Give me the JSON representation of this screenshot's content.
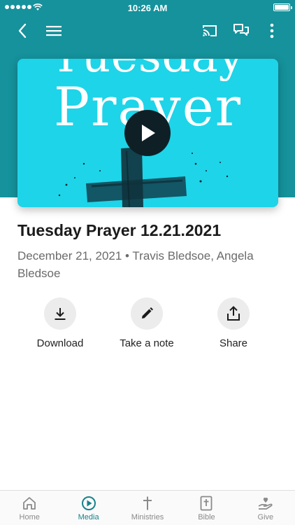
{
  "status_bar": {
    "time": "10:26 AM"
  },
  "header": {
    "back_icon": "chevron-left-icon",
    "menu_icon": "hamburger-icon",
    "cast_icon": "cast-icon",
    "chat_icon": "chat-bubbles-icon",
    "more_icon": "more-vertical-icon"
  },
  "hero": {
    "top_text": "Tuesday",
    "main_text": "Prayer",
    "background_color": "#1ed4e8",
    "play_icon": "play-icon"
  },
  "media": {
    "title": "Tuesday Prayer 12.21.2021",
    "meta": "December 21, 2021 • Travis Bledsoe, Angela Bledsoe"
  },
  "actions": [
    {
      "label": "Download",
      "icon": "download-icon"
    },
    {
      "label": "Take a note",
      "icon": "pencil-icon"
    },
    {
      "label": "Share",
      "icon": "share-icon"
    }
  ],
  "tabs": [
    {
      "label": "Home",
      "icon": "home-icon",
      "active": false
    },
    {
      "label": "Media",
      "icon": "play-circle-icon",
      "active": true
    },
    {
      "label": "Ministries",
      "icon": "cross-icon",
      "active": false
    },
    {
      "label": "Bible",
      "icon": "bible-icon",
      "active": false
    },
    {
      "label": "Give",
      "icon": "give-heart-icon",
      "active": false
    }
  ],
  "colors": {
    "header_teal": "#15929c",
    "accent": "#17828c"
  }
}
